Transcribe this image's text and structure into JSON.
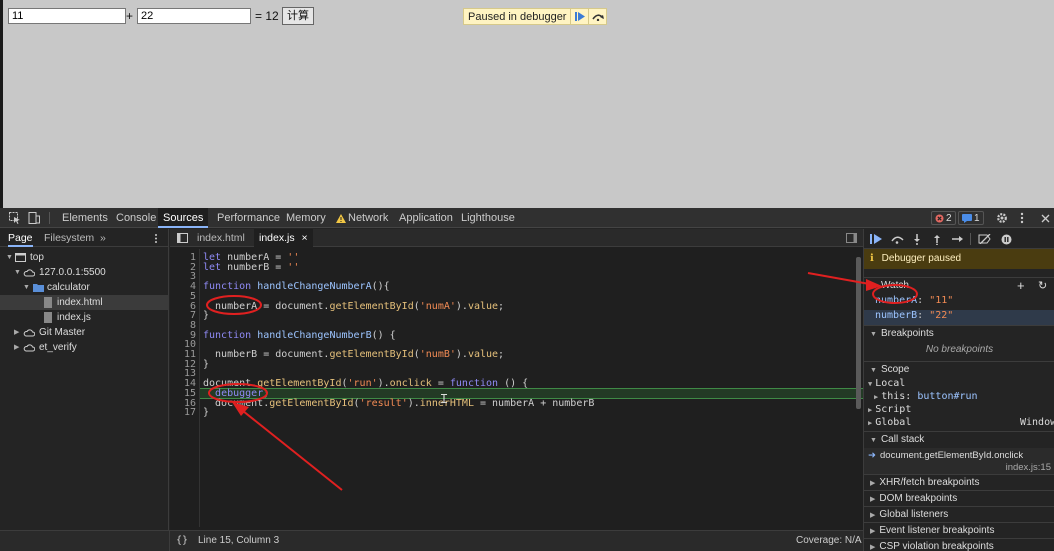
{
  "page": {
    "inputA_value": "11",
    "plus": "+",
    "inputB_value": "22",
    "equals_result": "= 12",
    "calc_button": "计算",
    "paused_overlay": "Paused in debugger"
  },
  "devtools": {
    "tabs": [
      "Elements",
      "Console",
      "Sources",
      "Performance",
      "Memory",
      "Network",
      "Application",
      "Lighthouse"
    ],
    "active_tab": "Sources",
    "error_count": "2",
    "message_count": "1",
    "colors": {
      "accent": "#8ab4f8",
      "exec_line": "#233a25",
      "paused_banner": "#4a3c10",
      "annotation": "#e02020",
      "warning": "#f2c744"
    }
  },
  "navigator": {
    "tabs": [
      "Page",
      "Filesystem"
    ],
    "more": "»",
    "tree": [
      {
        "label": "top",
        "icon": "frame-icon"
      },
      {
        "label": "127.0.0.1:5500",
        "icon": "cloud-icon"
      },
      {
        "label": "calculator",
        "icon": "folder-icon"
      },
      {
        "label": "index.html",
        "icon": "file-icon"
      },
      {
        "label": "index.js",
        "icon": "file-icon"
      },
      {
        "label": "Git Master",
        "icon": "cloud-icon"
      },
      {
        "label": "et_verify",
        "icon": "cloud-icon"
      }
    ]
  },
  "editor": {
    "tabs": [
      "index.html",
      "index.js"
    ],
    "active_tab": "index.js",
    "close": "×",
    "lines": [
      "let numberA = ''",
      "let numberB = ''",
      "",
      "function handleChangeNumberA(){",
      "",
      "  numberA = document.getElementById('numA').value;",
      "}",
      "",
      "function handleChangeNumberB() {",
      "",
      "  numberB = document.getElementById('numB').value;",
      "}",
      "",
      "document.getElementById('run').onclick = function () {",
      "  debugger;",
      "  document.getElementById('result').innerHTML = numberA + numberB",
      "}"
    ],
    "status_position": "Line 15, Column 3",
    "coverage": "Coverage: N/A",
    "format_icon": "{}"
  },
  "sidebar": {
    "paused_banner": "Debugger paused",
    "watch_title": "Watch",
    "watch": [
      {
        "name": "numberA",
        "value": "\"11\""
      },
      {
        "name": "numberB",
        "value": "\"22\""
      }
    ],
    "breakpoints_title": "Breakpoints",
    "no_breakpoints": "No breakpoints",
    "scope_title": "Scope",
    "scope_local": "Local",
    "scope_this_key": "this:",
    "scope_this_value": "button#run",
    "scope_script": "Script",
    "scope_global": "Global",
    "scope_global_value": "Window",
    "callstack_title": "Call stack",
    "callstack_frame": "document.getElementById.onclick",
    "callstack_loc": "index.js:15",
    "panes": [
      "XHR/fetch breakpoints",
      "DOM breakpoints",
      "Global listeners",
      "Event listener breakpoints",
      "CSP violation breakpoints"
    ]
  }
}
